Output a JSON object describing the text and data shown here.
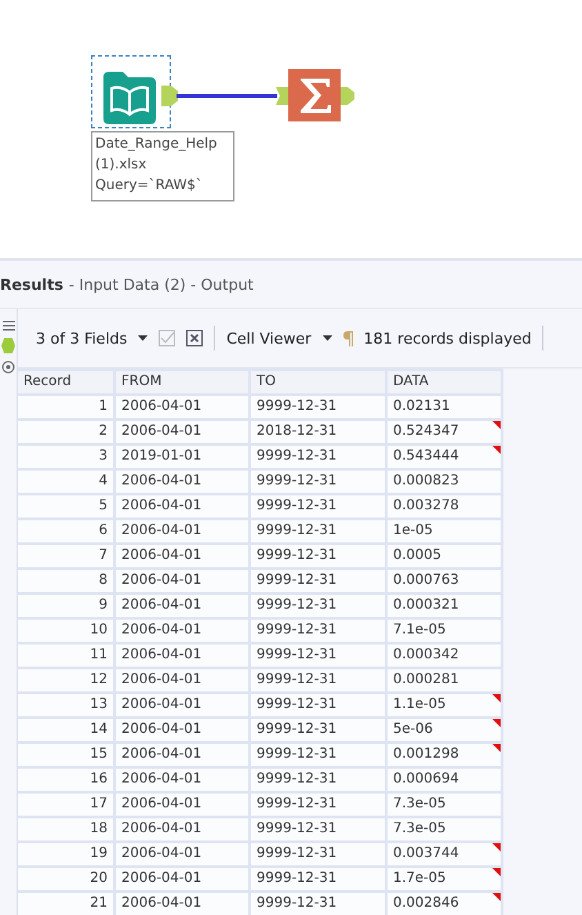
{
  "canvas": {
    "tools": [
      {
        "kind": "input",
        "selected": true,
        "annotation": [
          "Date_Range_Help",
          "(1).xlsx",
          "Query=`RAW$`"
        ]
      },
      {
        "kind": "summarize",
        "selected": false
      }
    ]
  },
  "results": {
    "title": "Results",
    "subtitle": "- Input Data (2) - Output"
  },
  "toolbar": {
    "fields": "3 of 3 Fields",
    "viewer": "Cell Viewer",
    "records": "181 records displayed"
  },
  "table": {
    "columns": [
      "Record",
      "FROM",
      "TO",
      "DATA"
    ],
    "rows": [
      {
        "cells": [
          "1",
          "2006-04-01",
          "9999-12-31",
          "0.02131"
        ],
        "flagged": false
      },
      {
        "cells": [
          "2",
          "2006-04-01",
          "2018-12-31",
          "0.524347"
        ],
        "flagged": true
      },
      {
        "cells": [
          "3",
          "2019-01-01",
          "9999-12-31",
          "0.543444"
        ],
        "flagged": true
      },
      {
        "cells": [
          "4",
          "2006-04-01",
          "9999-12-31",
          "0.000823"
        ],
        "flagged": false
      },
      {
        "cells": [
          "5",
          "2006-04-01",
          "9999-12-31",
          "0.003278"
        ],
        "flagged": false
      },
      {
        "cells": [
          "6",
          "2006-04-01",
          "9999-12-31",
          "1e-05"
        ],
        "flagged": false
      },
      {
        "cells": [
          "7",
          "2006-04-01",
          "9999-12-31",
          "0.0005"
        ],
        "flagged": false
      },
      {
        "cells": [
          "8",
          "2006-04-01",
          "9999-12-31",
          "0.000763"
        ],
        "flagged": false
      },
      {
        "cells": [
          "9",
          "2006-04-01",
          "9999-12-31",
          "0.000321"
        ],
        "flagged": false
      },
      {
        "cells": [
          "10",
          "2006-04-01",
          "9999-12-31",
          "7.1e-05"
        ],
        "flagged": false
      },
      {
        "cells": [
          "11",
          "2006-04-01",
          "9999-12-31",
          "0.000342"
        ],
        "flagged": false
      },
      {
        "cells": [
          "12",
          "2006-04-01",
          "9999-12-31",
          "0.000281"
        ],
        "flagged": false
      },
      {
        "cells": [
          "13",
          "2006-04-01",
          "9999-12-31",
          "1.1e-05"
        ],
        "flagged": true
      },
      {
        "cells": [
          "14",
          "2006-04-01",
          "9999-12-31",
          "5e-06"
        ],
        "flagged": true
      },
      {
        "cells": [
          "15",
          "2006-04-01",
          "9999-12-31",
          "0.001298"
        ],
        "flagged": true
      },
      {
        "cells": [
          "16",
          "2006-04-01",
          "9999-12-31",
          "0.000694"
        ],
        "flagged": false
      },
      {
        "cells": [
          "17",
          "2006-04-01",
          "9999-12-31",
          "7.3e-05"
        ],
        "flagged": false
      },
      {
        "cells": [
          "18",
          "2006-04-01",
          "9999-12-31",
          "7.3e-05"
        ],
        "flagged": false
      },
      {
        "cells": [
          "19",
          "2006-04-01",
          "9999-12-31",
          "0.003744"
        ],
        "flagged": true
      },
      {
        "cells": [
          "20",
          "2006-04-01",
          "9999-12-31",
          "1.7e-05"
        ],
        "flagged": true
      },
      {
        "cells": [
          "21",
          "2006-04-01",
          "9999-12-31",
          "0.002846"
        ],
        "flagged": true
      }
    ]
  }
}
